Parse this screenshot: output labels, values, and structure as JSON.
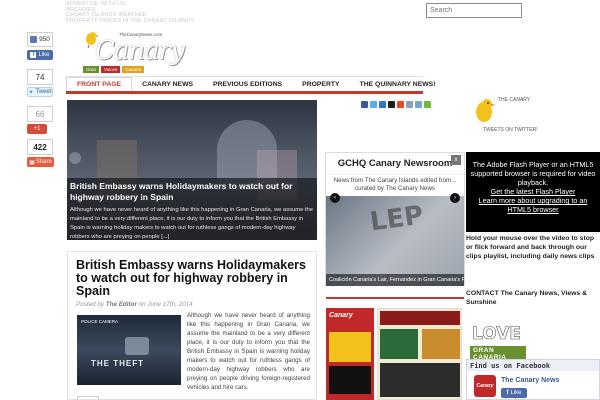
{
  "top_links": [
    "ADVERTISE WITH US",
    "ARCHIVES",
    "CANARY ISLANDS WEATHER",
    "PROPERTY PRICES IN THE CANARY ISLANDS"
  ],
  "search": {
    "placeholder": "Search"
  },
  "social": {
    "facebook_count": "950",
    "facebook_like_label": "Like",
    "twitter_count": "74",
    "tweet_label": "Tweet",
    "gplus_count": "66",
    "gplus_label": "+1",
    "share_count": "422",
    "share_label": "Share"
  },
  "logo": {
    "url": "TheCanaryNews.com",
    "title": "Canary",
    "tags": [
      "Gran",
      "Voices",
      "Canaria"
    ]
  },
  "nav": {
    "items": [
      "FRONT PAGE",
      "CANARY NEWS",
      "PREVIOUS EDITIONS",
      "PROPERTY",
      "THE QUINNARY NEWS!"
    ]
  },
  "hero": {
    "title": "British Embassy warns Holidaymakers to watch out for highway robbery in Spain",
    "excerpt": "Although we have never heard of anything like this happening in Gran Canaria, we assume the mainland to be a very different place, it is our duty to inform you that the British Embassy in Spain is warning holiday makers to watch out for ruthless gangs of modern-day highway robbers who are preying on people [...]"
  },
  "newsroom": {
    "title": "GCHQ Canary Newsroom",
    "subtitle": "News from The Canary Islands edited from... curated by The Canary News",
    "close_label": "x",
    "image_text": "LEP",
    "caption": "Coalición Canaria's Lair, Fernandez in Gran Canaria's Pueblo",
    "prev_label": "‹",
    "next_label": "›"
  },
  "article": {
    "title": "British Embassy warns Holidaymakers to watch out for highway robbery in Spain",
    "meta_prefix": "Posted by",
    "author": "The Editor",
    "meta_date": "on June 17th, 2014",
    "thumb_label": "THE THEFT",
    "thumb_logo": "POLICE CAMERA",
    "body": "Although we have never heard of anything like this happening in Gran Canaria, we assume the mainland to be a very different place, it is our duty to inform you that the British Embassy in Spain is warning holiday makers to watch out for ruthless gangs of modern-day highway robbers who are preying on people driving foreign-registered vehicles and hire cars."
  },
  "ads": {
    "ad1_title": "Canary"
  },
  "sidebar": {
    "bird_label": "THE CANARY",
    "tweets_label": "TWEETS ON TWITTER!",
    "flash_text": "The Adobe Flash Player or an HTML5 supported browser is required for video playback.",
    "flash_link1": "Get the latest Flash Player",
    "flash_link2": "Learn more about upgrading to an HTML5 browser",
    "hold_text": "Hold your mouse over the video to stop or flick forward and back through our clips playlist, including daily news clips",
    "contact_text": "CONTACT The Canary News, Views & Sunshine",
    "love_text": "LOVE",
    "love_sub": "GRAN CANARIA",
    "fb_header": "Find us on Facebook",
    "fb_logo_text": "Canary",
    "fb_page_name": "The Canary News",
    "fb_like_label": "Like"
  },
  "colors": {
    "accent_red": "#c43b2c",
    "facebook_blue": "#4c69a9",
    "logo_yellow": "#f2c11b"
  }
}
